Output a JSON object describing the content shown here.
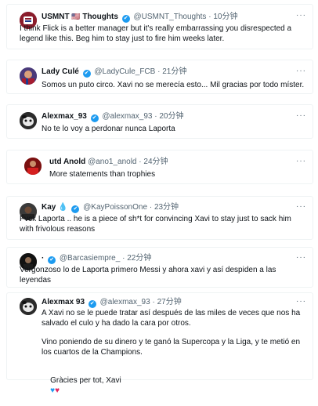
{
  "tweets": [
    {
      "name": "USMNT",
      "name_suffix": "Thoughts",
      "flag": "🇺🇸",
      "handle": "@USMNT_Thoughts",
      "time": "10分钟",
      "text": "I think Flick is a better manager but it's really embarrassing you disrespected a legend like this. Beg him to stay just to fire him weeks later.",
      "verified": true
    },
    {
      "name": "Lady Culé",
      "handle": "@LadyCule_FCB",
      "time": "21分钟",
      "text": "Somos un puto circo. Xavi no se merecía esto... Mil gracias por todo míster.",
      "verified": true
    },
    {
      "name": "Alexmax_93",
      "handle": "@alexmax_93",
      "time": "20分钟",
      "text": "No te lo voy a perdonar nunca Laporta",
      "verified": true
    },
    {
      "name": "utd Anold",
      "handle": "@ano1_anold",
      "time": "24分钟",
      "text": "More statements than trophies",
      "verified": false
    },
    {
      "name": "Kay",
      "handle": "@KayPoissonOne",
      "time": "23分钟",
      "text": "Fvck Laporta .. he is a piece of sh*t for convincing Xavi to stay just to sack him with frivolous reasons",
      "verified": true
    },
    {
      "name": "·",
      "handle": "@Barcasiempre_",
      "time": "22分钟",
      "text": "Vergonzoso lo de Laporta primero Messi y ahora xavi y así despiden a las leyendas",
      "verified": true
    },
    {
      "name": "Alexmax 93",
      "handle": "@alexmax_93",
      "time": "27分钟",
      "text_p1": "A Xavi no se le puede tratar así después de las miles de veces que nos ha salvado el culo y ha dado la cara por otros.",
      "text_p2": "Vino poniendo de su dinero y te ganó la Supercopa y la Liga, y te metió en los cuartos de la Champions.",
      "text_p3": "Gràcies per tot, Xavi",
      "verified": true
    }
  ],
  "icons": {
    "verified": "✔",
    "more": "···",
    "dot": "·",
    "drop": "💧",
    "heart_blue": "♥",
    "heart_red": "♥"
  },
  "colors": {
    "accent": "#1d9bf0",
    "muted": "#536471",
    "border": "#eff3f4"
  }
}
